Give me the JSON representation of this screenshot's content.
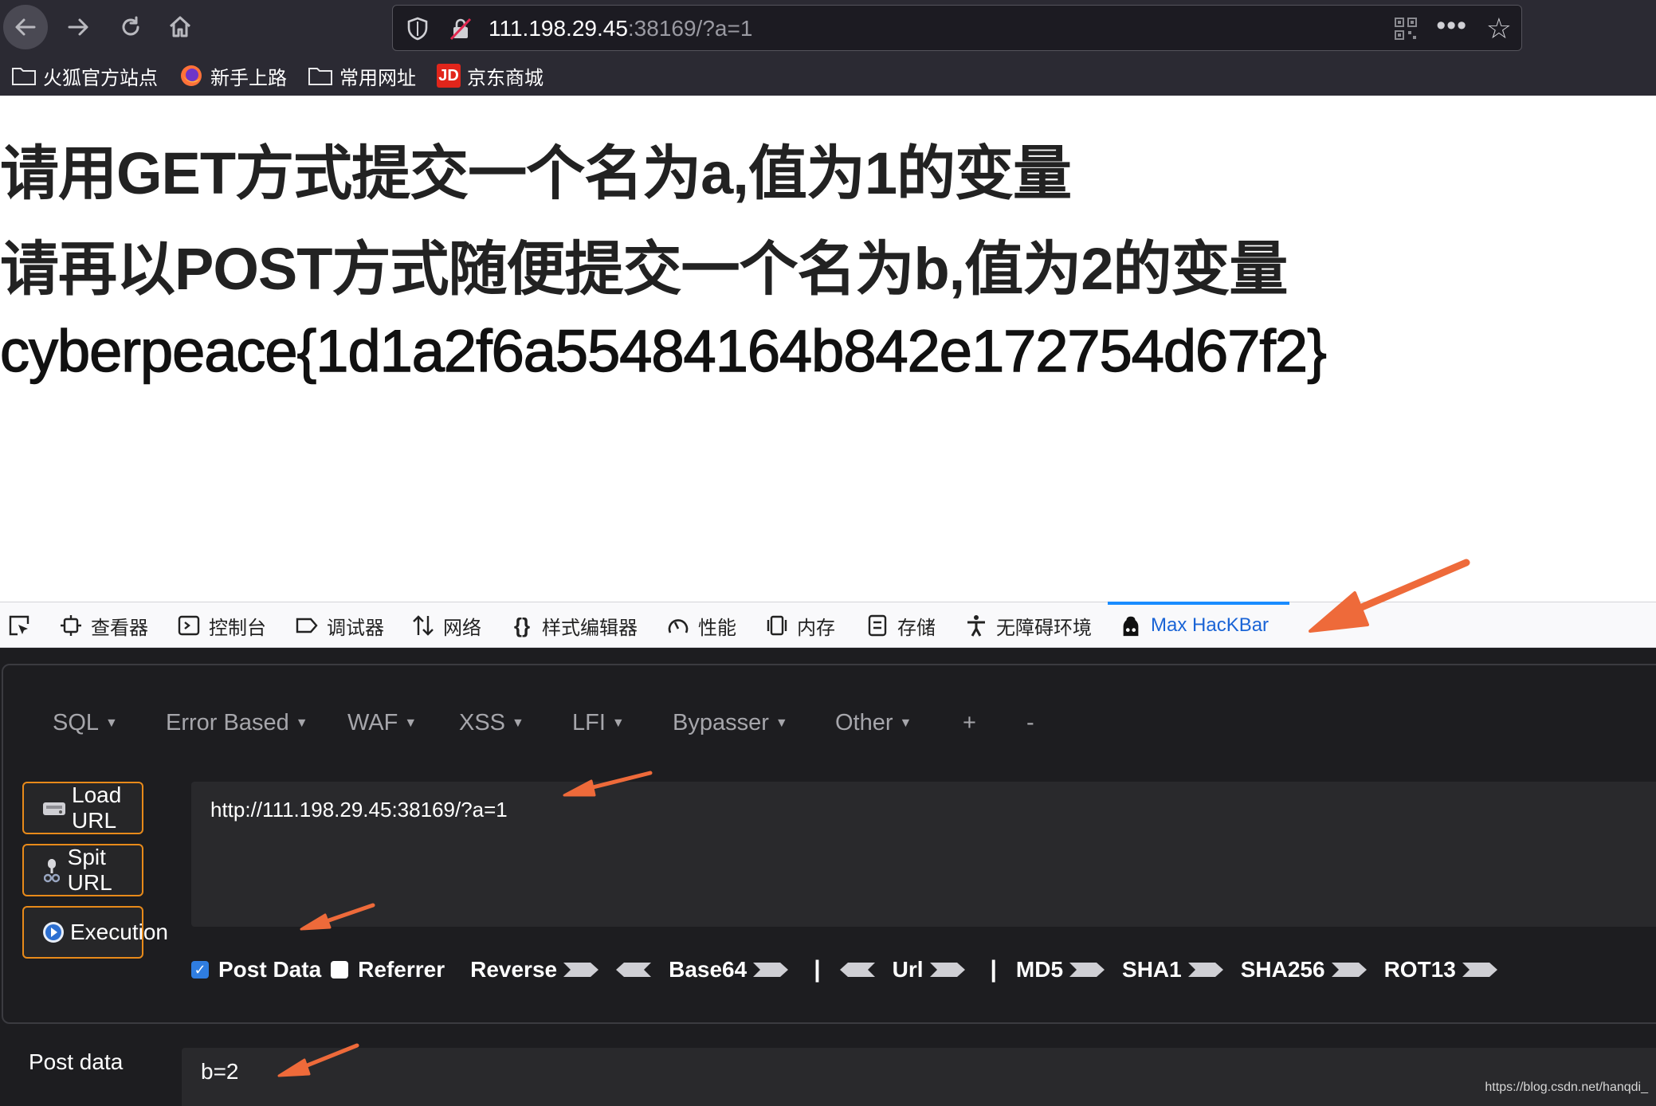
{
  "browser": {
    "url_host": "111.198.29.45",
    "url_rest": ":38169/?a=1",
    "bookmarks": [
      {
        "label": "火狐官方站点",
        "icon": "folder-icon"
      },
      {
        "label": "新手上路",
        "icon": "firefox-icon"
      },
      {
        "label": "常用网址",
        "icon": "folder-icon"
      },
      {
        "label": "京东商城",
        "icon": "jd-icon",
        "icon_text": "JD"
      }
    ]
  },
  "page": {
    "line1": "请用GET方式提交一个名为a,值为1的变量",
    "line2": "请再以POST方式随便提交一个名为b,值为2的变量",
    "line3": "cyberpeace{1d1a2f6a55484164b842e172754d67f2}"
  },
  "devtools": {
    "tabs": [
      {
        "label": "查看器",
        "icon": "inspector-icon"
      },
      {
        "label": "控制台",
        "icon": "console-icon"
      },
      {
        "label": "调试器",
        "icon": "debugger-icon"
      },
      {
        "label": "网络",
        "icon": "network-icon"
      },
      {
        "label": "样式编辑器",
        "icon": "style-editor-icon"
      },
      {
        "label": "性能",
        "icon": "performance-icon"
      },
      {
        "label": "内存",
        "icon": "memory-icon"
      },
      {
        "label": "存储",
        "icon": "storage-icon"
      },
      {
        "label": "无障碍环境",
        "icon": "accessibility-icon"
      },
      {
        "label": "Max HacKBar",
        "icon": "hackbar-icon",
        "active": true
      }
    ],
    "active_color": "#1a64d6"
  },
  "hackbar": {
    "menus": [
      "SQL",
      "Error Based",
      "WAF",
      "XSS",
      "LFI",
      "Bypasser",
      "Other"
    ],
    "plus": "+",
    "minus": "-",
    "buttons": {
      "load": "Load URL",
      "split": "Spit URL",
      "exec": "Execution"
    },
    "url_value": "http://111.198.29.45:38169/?a=1",
    "options": {
      "post_data": "Post Data",
      "post_data_checked": true,
      "referrer": "Referrer",
      "referrer_checked": false,
      "reverse": "Reverse",
      "base64": "Base64",
      "url": "Url",
      "md5": "MD5",
      "sha1": "SHA1",
      "sha256": "SHA256",
      "rot13": "ROT13",
      "separator": "|"
    },
    "post_label": "Post data",
    "post_value": "b=2",
    "accent_color": "#e88a1a"
  },
  "watermark": "https://blog.csdn.net/hanqdi_"
}
